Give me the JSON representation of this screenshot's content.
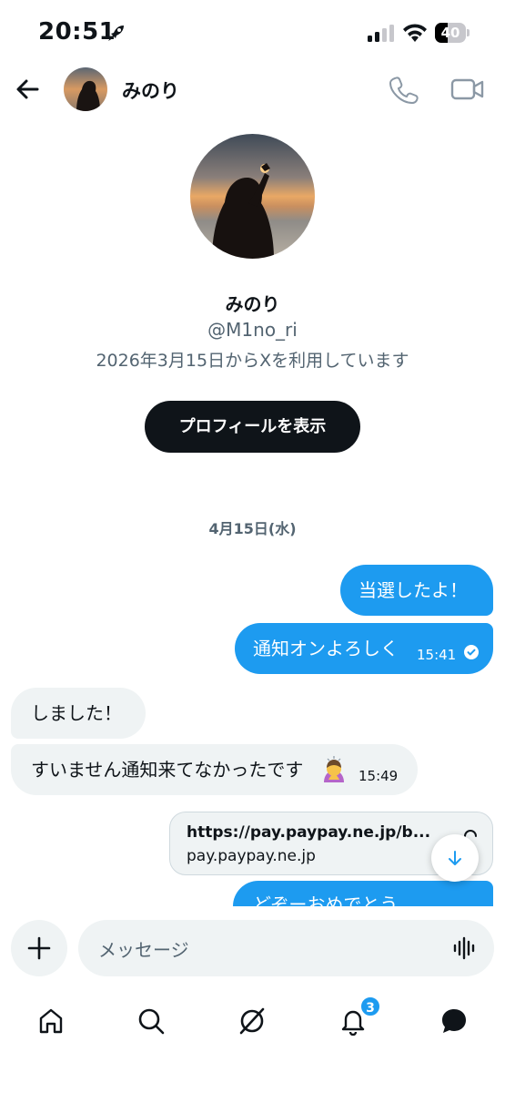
{
  "status_bar": {
    "time": "20:51",
    "battery": "40",
    "battery_level": 0.4,
    "icons": [
      "rocket-icon",
      "signal-icon",
      "wifi-icon",
      "battery-icon"
    ]
  },
  "header": {
    "name": "みのり",
    "icons": [
      "back-arrow-icon",
      "phone-icon",
      "video-icon"
    ]
  },
  "profile": {
    "name": "みのり",
    "handle": "@M1no_ri",
    "joined": "2026年3月15日からXを利用しています",
    "button_label": "プロフィールを表示"
  },
  "conversation": {
    "date_separator": "4月15日(水)",
    "messages": [
      {
        "direction": "outgoing",
        "text": "当選したよ！",
        "time": ""
      },
      {
        "direction": "outgoing",
        "text": "通知オンよろしく",
        "time": "15:41",
        "status": "read"
      },
      {
        "direction": "incoming",
        "text": "しました！",
        "time": ""
      },
      {
        "direction": "incoming",
        "text": "すいません通知来てなかったです",
        "time": "15:49",
        "emoji": "bowing-person-emoji"
      },
      {
        "direction": "outgoing",
        "type": "link",
        "title": "https://pay.paypay.ne.jp/b...",
        "domain": "pay.paypay.ne.jp"
      },
      {
        "direction": "outgoing",
        "text": "どぞーおめでとう",
        "time": ""
      }
    ]
  },
  "composer": {
    "placeholder": "メッセージ",
    "icons": [
      "plus-icon",
      "voice-icon"
    ]
  },
  "bottom_nav": {
    "items": [
      "home",
      "search",
      "grok",
      "notifications",
      "messages"
    ],
    "notification_count": "3"
  },
  "colors": {
    "accent": "#1d9bf0",
    "incoming_bubble": "#eff3f4",
    "text_primary": "#0f1419",
    "text_secondary": "#536471"
  }
}
